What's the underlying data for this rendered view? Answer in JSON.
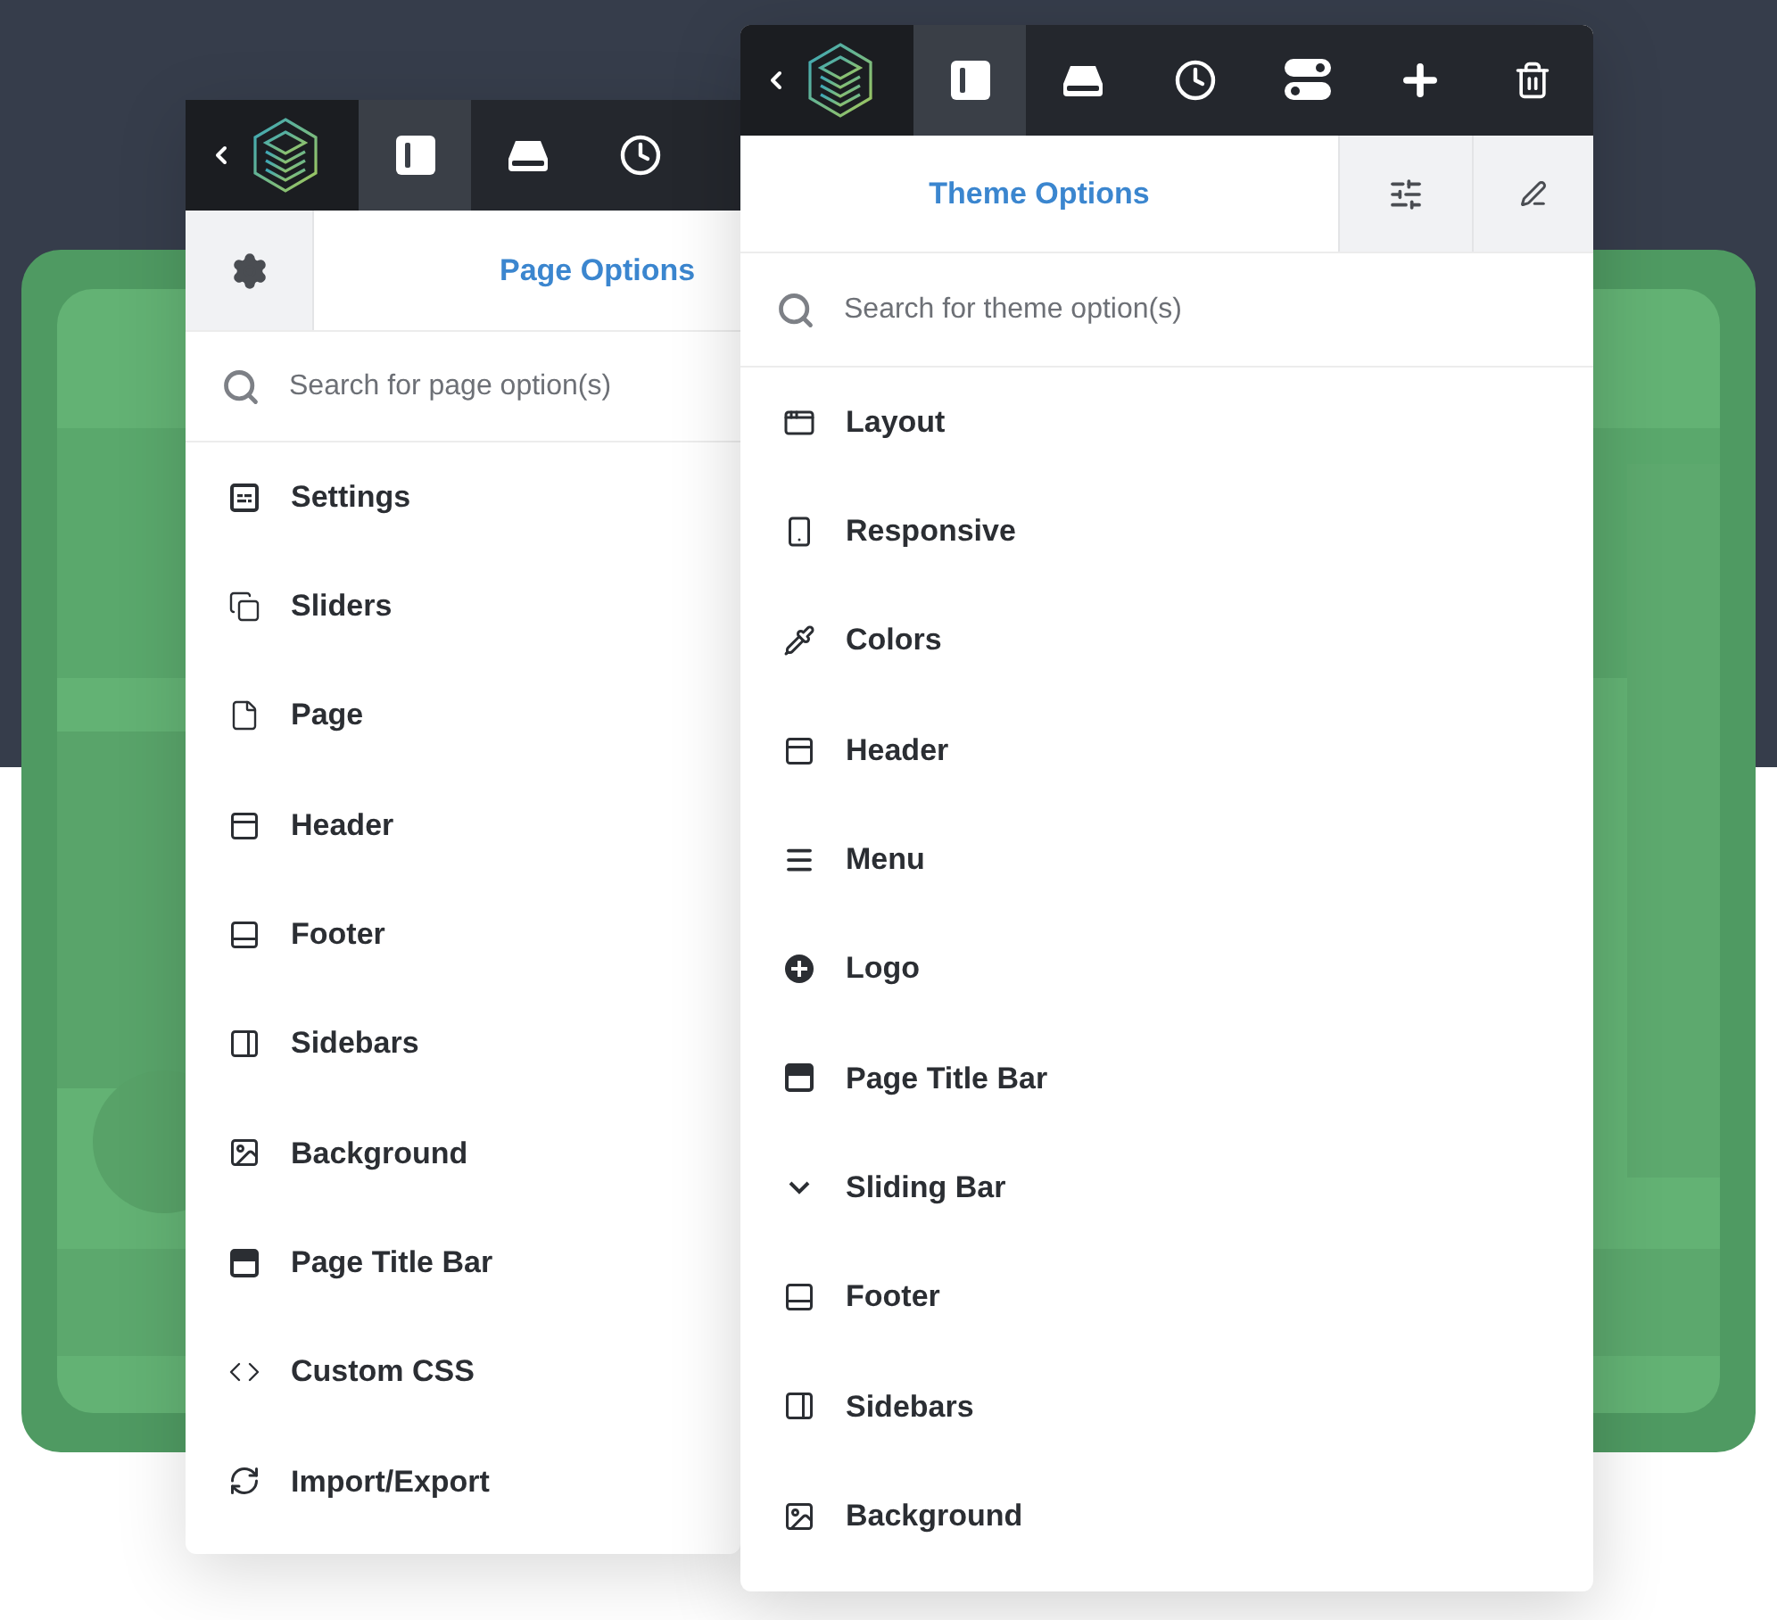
{
  "page_panel": {
    "toolbar": [
      {
        "kind": "layout",
        "selected": true
      },
      {
        "kind": "drive",
        "selected": false
      },
      {
        "kind": "history",
        "selected": false
      }
    ],
    "title": "Page Options",
    "search": {
      "placeholder": "Search for page option(s)"
    },
    "items": [
      {
        "kind": "settings",
        "label": "Settings"
      },
      {
        "kind": "sliders",
        "label": "Sliders"
      },
      {
        "kind": "page",
        "label": "Page"
      },
      {
        "kind": "header",
        "label": "Header"
      },
      {
        "kind": "footer",
        "label": "Footer"
      },
      {
        "kind": "sidebars",
        "label": "Sidebars"
      },
      {
        "kind": "background",
        "label": "Background"
      },
      {
        "kind": "titlebar",
        "label": "Page Title Bar"
      },
      {
        "kind": "css",
        "label": "Custom CSS"
      },
      {
        "kind": "importexport",
        "label": "Import/Export"
      }
    ]
  },
  "theme_panel": {
    "toolbar": [
      {
        "kind": "layout",
        "selected": true
      },
      {
        "kind": "drive",
        "selected": false
      },
      {
        "kind": "history",
        "selected": false
      },
      {
        "kind": "toggles",
        "selected": false
      },
      {
        "kind": "add",
        "selected": false
      },
      {
        "kind": "delete",
        "selected": false
      }
    ],
    "title": "Theme Options",
    "search": {
      "placeholder": "Search for theme option(s)"
    },
    "items": [
      {
        "kind": "layout",
        "label": "Layout"
      },
      {
        "kind": "responsive",
        "label": "Responsive"
      },
      {
        "kind": "colors",
        "label": "Colors"
      },
      {
        "kind": "header",
        "label": "Header"
      },
      {
        "kind": "menu",
        "label": "Menu"
      },
      {
        "kind": "logo",
        "label": "Logo"
      },
      {
        "kind": "titlebar",
        "label": "Page Title Bar"
      },
      {
        "kind": "slidingbar",
        "label": "Sliding Bar"
      },
      {
        "kind": "footer",
        "label": "Footer"
      },
      {
        "kind": "sidebars",
        "label": "Sidebars"
      },
      {
        "kind": "background",
        "label": "Background"
      }
    ]
  }
}
